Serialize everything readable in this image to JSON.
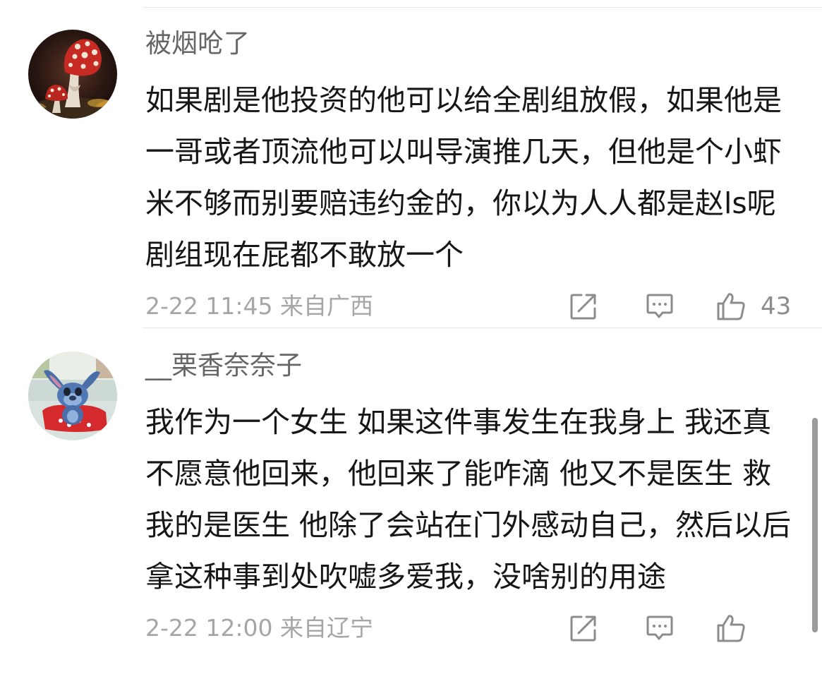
{
  "comments": [
    {
      "username": "被烟呛了",
      "text": "如果剧是他投资的他可以给全剧组放假，如果他是一哥或者顶流他可以叫导演推几天，但他是个小虾米不够而别要赔违约金的，你以为人人都是赵ls呢剧组现在屁都不敢放一个",
      "meta": "2-22 11:45 来自广西",
      "likes": "43",
      "avatar_icon": "mushroom-avatar",
      "actions": [
        "share-icon",
        "reply-icon",
        "like-icon"
      ]
    },
    {
      "username": "__栗香奈奈子",
      "text": "我作为一个女生 如果这件事发生在我身上 我还真不愿意他回来，他回来了能咋滴 他又不是医生 救我的是医生 他除了会站在门外感动自己，然后以后拿这种事到处吹嘘多爱我，没啥别的用途",
      "meta": "2-22 12:00 来自辽宁",
      "avatar_icon": "stitch-avatar",
      "actions": [
        "share-icon",
        "reply-icon",
        "like-icon"
      ]
    }
  ],
  "colors": {
    "username": "#666666",
    "text": "#161616",
    "meta": "#a6a6a6",
    "icon": "#8c8c8c",
    "divider": "#e7e7e7"
  }
}
